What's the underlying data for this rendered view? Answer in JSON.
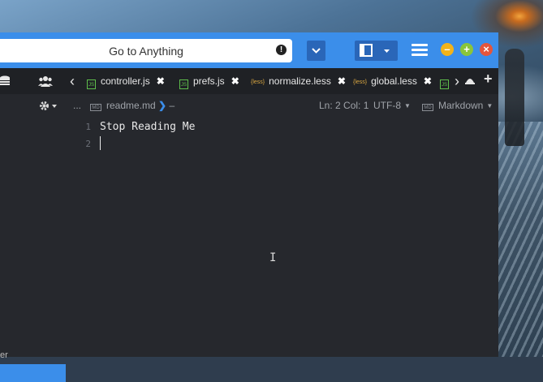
{
  "window": {
    "goto_placeholder": "Go to Anything",
    "goto_alert_glyph": "!",
    "minimize_glyph": "–",
    "maximize_glyph": "+",
    "close_glyph": "×"
  },
  "tabs": [
    {
      "label": "controller.js",
      "type": "js"
    },
    {
      "label": "prefs.js",
      "type": "js"
    },
    {
      "label": "normalize.less",
      "type": "less"
    },
    {
      "label": "global.less",
      "type": "less"
    }
  ],
  "tab_close_glyph": "✖",
  "tab_nav": {
    "prev": "‹",
    "next": "›",
    "add": "+"
  },
  "breadcrumb": {
    "ellipsis": "...",
    "file_icon_text": "MD",
    "file": "readme.md",
    "separator": "❯",
    "trail": "–"
  },
  "statusbar": {
    "position": "Ln: 2 Col: 1",
    "encoding": "UTF-8",
    "language": "Markdown",
    "lang_icon_text": "MD"
  },
  "editor": {
    "lines": [
      {
        "number": "1",
        "text": "Stop Reading Me"
      },
      {
        "number": "2",
        "text": ""
      }
    ]
  },
  "sidebar": {
    "label_fragment": "er"
  },
  "colors": {
    "accent": "#3b8eea",
    "editor_bg": "#26282d",
    "tabbar_bg": "#1f2125"
  }
}
